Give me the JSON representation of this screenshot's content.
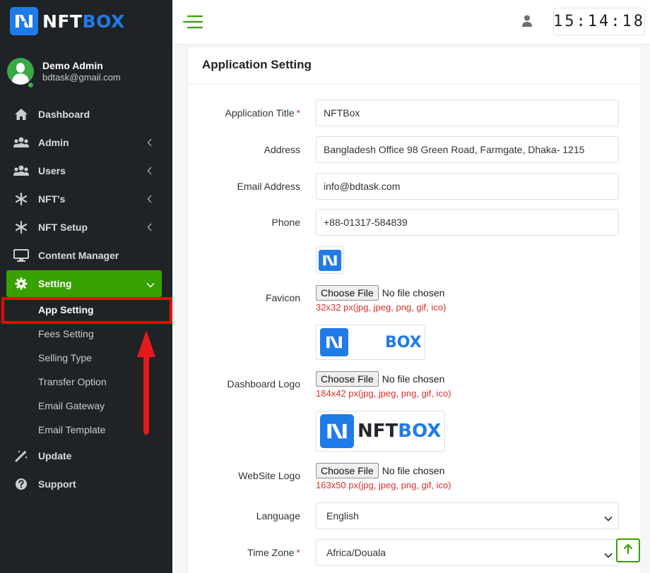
{
  "brand": {
    "name_part1": "NFT",
    "name_part2": "BOX",
    "accent": "#1f7be8"
  },
  "user": {
    "name": "Demo Admin",
    "email": "bdtask@gmail.com",
    "status": "online"
  },
  "sidebar": {
    "items": [
      {
        "label": "Dashboard",
        "icon": "home-icon"
      },
      {
        "label": "Admin",
        "icon": "users-icon"
      },
      {
        "label": "Users",
        "icon": "users-icon"
      },
      {
        "label": "NFT's",
        "icon": "snowflake-icon"
      },
      {
        "label": "NFT Setup",
        "icon": "snowflake-icon"
      },
      {
        "label": "Content Manager",
        "icon": "monitor-icon"
      },
      {
        "label": "Setting",
        "icon": "gear-icon",
        "active": true
      },
      {
        "label": "Update",
        "icon": "magic-wand-icon"
      },
      {
        "label": "Support",
        "icon": "question-icon"
      }
    ],
    "setting_sub": [
      {
        "label": "App Setting",
        "current": true
      },
      {
        "label": "Fees Setting"
      },
      {
        "label": "Selling Type"
      },
      {
        "label": "Transfer Option"
      },
      {
        "label": "Email Gateway"
      },
      {
        "label": "Email Template"
      }
    ]
  },
  "topbar": {
    "clock": "15:14:18"
  },
  "form": {
    "title": "Application Setting",
    "required_mark": "*",
    "application_title": {
      "label": "Application Title",
      "value": "NFTBox"
    },
    "address": {
      "label": "Address",
      "value": "Bangladesh Office 98 Green Road, Farmgate, Dhaka- 1215"
    },
    "email": {
      "label": "Email Address",
      "value": "info@bdtask.com"
    },
    "phone": {
      "label": "Phone",
      "value": "+88-01317-584839"
    },
    "favicon": {
      "label": "Favicon",
      "button": "Choose File",
      "status": "No file chosen",
      "hint": "32x32 px(jpg, jpeg, png, gif, ico)"
    },
    "dashboard_logo": {
      "label": "Dashboard Logo",
      "button": "Choose File",
      "status": "No file chosen",
      "hint": "184x42 px(jpg, jpeg, png, gif, ico)",
      "preview_text": "BOX"
    },
    "website_logo": {
      "label": "WebSite Logo",
      "button": "Choose File",
      "status": "No file chosen",
      "hint": "163x50 px(jpg, jpeg, png, gif, ico)",
      "preview_text_1": "NFT",
      "preview_text_2": "BOX"
    },
    "language": {
      "label": "Language",
      "value": "English"
    },
    "timezone": {
      "label": "Time Zone",
      "value": "Africa/Douala"
    }
  },
  "colors": {
    "sidebar_bg": "#1f2326",
    "active_green": "#37a100",
    "annotation_red": "#e6191b",
    "hint_red": "#d9302c"
  }
}
